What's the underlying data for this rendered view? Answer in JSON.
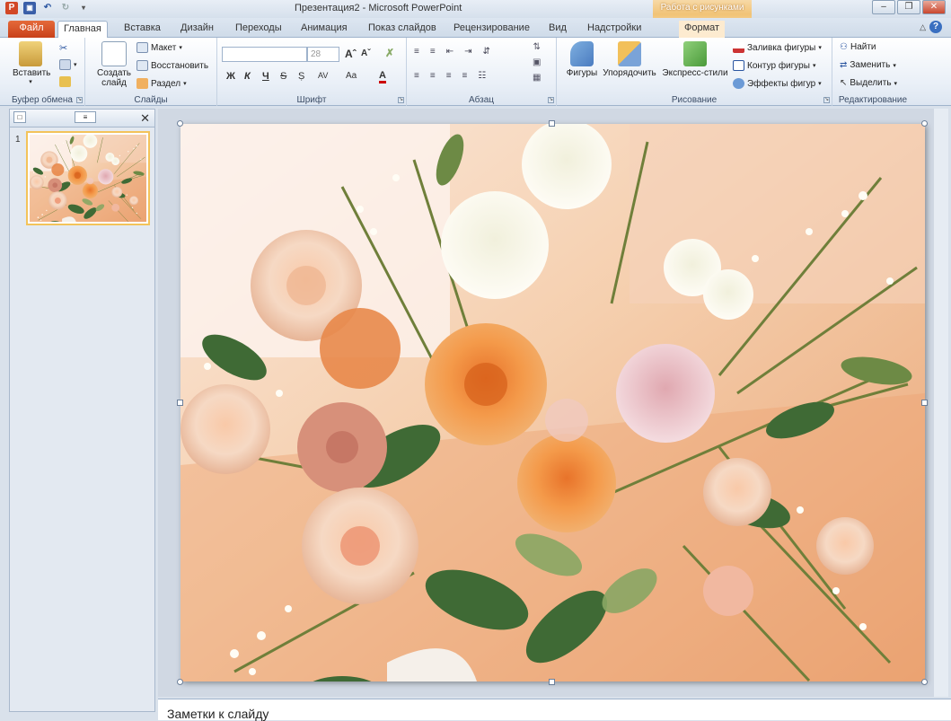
{
  "window": {
    "title": "Презентация2 - Microsoft PowerPoint",
    "context_tab_title": "Работа с рисунками"
  },
  "tabs": [
    {
      "label": "Файл"
    },
    {
      "label": "Главная"
    },
    {
      "label": "Вставка"
    },
    {
      "label": "Дизайн"
    },
    {
      "label": "Переходы"
    },
    {
      "label": "Анимация"
    },
    {
      "label": "Показ слайдов"
    },
    {
      "label": "Рецензирование"
    },
    {
      "label": "Вид"
    },
    {
      "label": "Надстройки"
    },
    {
      "label": "Формат"
    }
  ],
  "ribbon": {
    "clipboard": {
      "label": "Буфер обмена",
      "paste": "Вставить"
    },
    "slides": {
      "label": "Слайды",
      "new_slide_line1": "Создать",
      "new_slide_line2": "слайд",
      "layout": "Макет",
      "reset": "Восстановить",
      "section": "Раздел"
    },
    "font": {
      "label": "Шрифт",
      "size": "28",
      "bold": "Ж",
      "italic": "К",
      "underline": "Ч",
      "strike": "S",
      "spacing": "AV",
      "case": "Aa",
      "color": "A"
    },
    "paragraph": {
      "label": "Абзац"
    },
    "drawing": {
      "label": "Рисование",
      "shapes": "Фигуры",
      "arrange": "Упорядочить",
      "quick_styles": "Экспресс-стили",
      "fill": "Заливка фигуры",
      "outline": "Контур фигуры",
      "effects": "Эффекты фигур"
    },
    "editing": {
      "label": "Редактирование",
      "find": "Найти",
      "replace": "Заменить",
      "select": "Выделить"
    }
  },
  "slides_pane": {
    "slide_number": "1"
  },
  "notes": {
    "placeholder": "Заметки к слайду"
  },
  "colors": {
    "file_tab": "#c8401a",
    "selection": "#f3c35a",
    "ribbon_bg": "#e9eff7"
  }
}
